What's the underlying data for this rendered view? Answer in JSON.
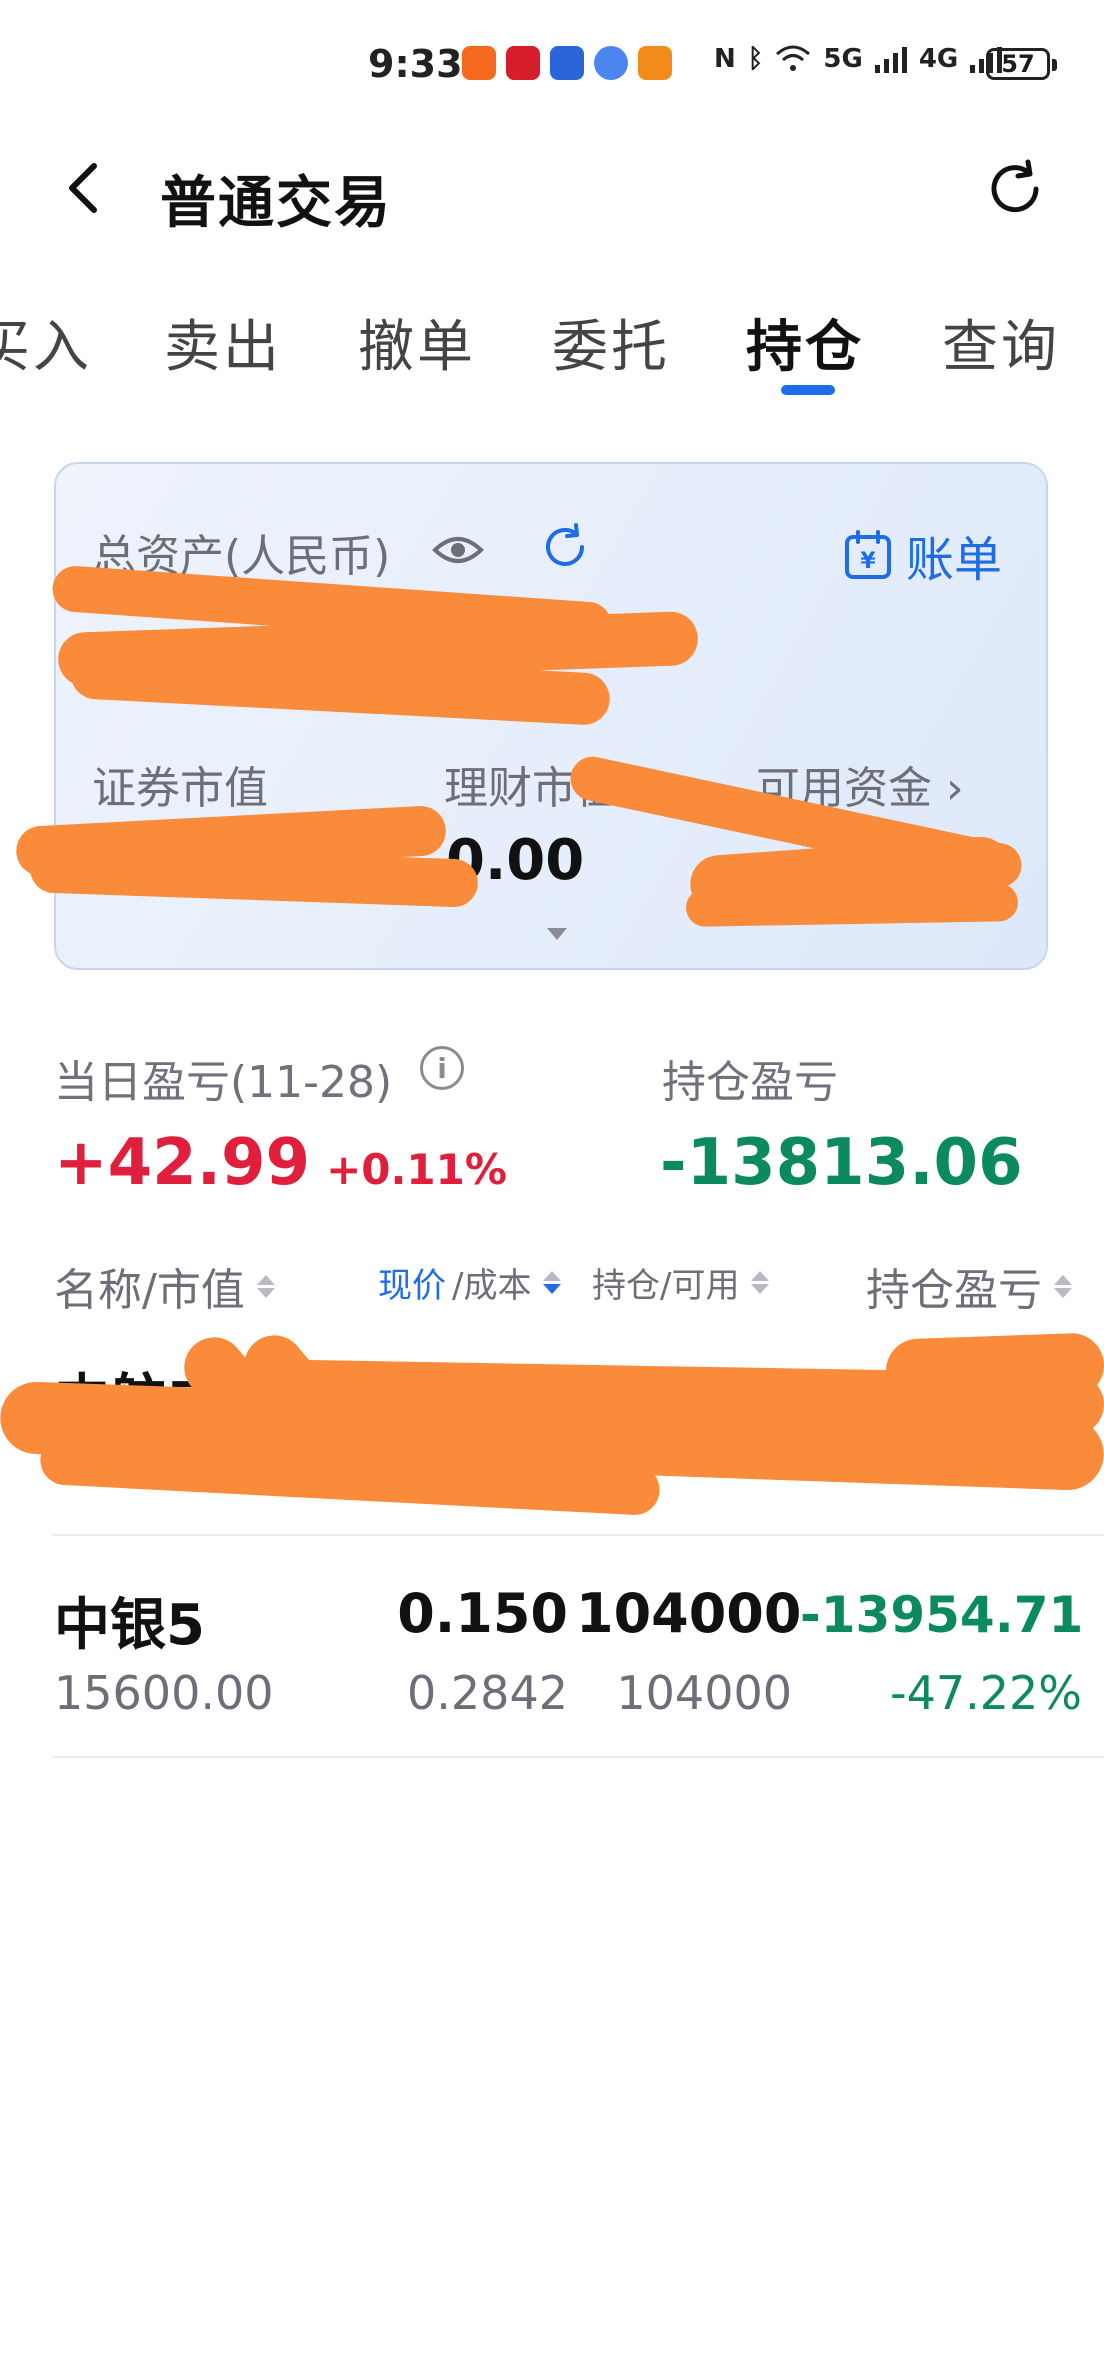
{
  "status_bar": {
    "time": "9:33",
    "battery": "57",
    "network_5g": "5G",
    "network_4g": "4G"
  },
  "header": {
    "title": "普通交易"
  },
  "tabs": [
    {
      "label": "买入"
    },
    {
      "label": "卖出"
    },
    {
      "label": "撤单"
    },
    {
      "label": "委托"
    },
    {
      "label": "持仓"
    },
    {
      "label": "查询"
    }
  ],
  "asset_card": {
    "total_label": "总资产(人民币)",
    "bill_label": "账单",
    "securities_value_label": "证券市值",
    "wealth_value_label": "理财市值",
    "available_funds_label": "可用资金",
    "wealth_value": "0.00"
  },
  "profit": {
    "daily_label": "当日盈亏(11-28)",
    "daily_value": "+42.99",
    "daily_percent": "+0.11%",
    "position_label": "持仓盈亏",
    "position_value": "-13813.06"
  },
  "table": {
    "headers": {
      "name_value": "名称/市值",
      "price_current": "现价",
      "price_sep_cost": "/成本",
      "position_available": "持仓/可用",
      "position_pnl": "持仓盈亏"
    },
    "rows": [
      {
        "name": "中航成",
        "pnl_percent": "%"
      },
      {
        "name": "中银5",
        "market_value": "15600.00",
        "price": "0.150",
        "cost": "0.2842",
        "position": "104000",
        "available": "104000",
        "pnl": "-13954.71",
        "pnl_percent": "-47.22%"
      }
    ]
  },
  "colors": {
    "accent": "#1e6ce6",
    "up": "#e01f3d",
    "down": "#0b8a5f",
    "redaction": "#f98b3a"
  }
}
